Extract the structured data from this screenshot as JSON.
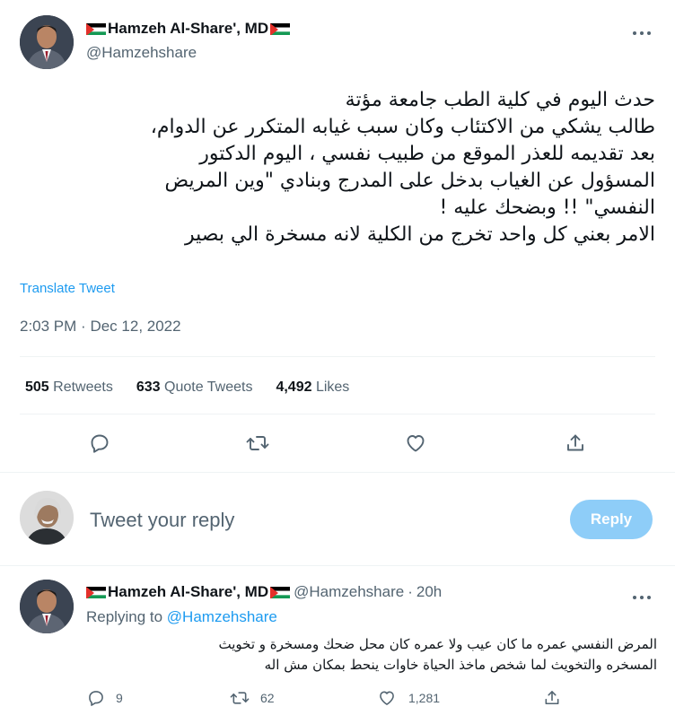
{
  "main_tweet": {
    "author_name": "Hamzeh Al-Share', MD",
    "author_handle": "@Hamzehshare",
    "text": "حدث اليوم في كلية الطب جامعة مؤتة\nطالب يشكي من الاكتئاب وكان سبب غيابه المتكرر عن الدوام،\nبعد تقديمه للعذر الموقع من طبيب نفسي ، اليوم الدكتور\nالمسؤول عن الغياب بدخل على المدرج وبنادي \"وين المريض\nالنفسي\" !! وبضحك عليه !\nالامر بعني كل واحد تخرج من الكلية لانه مسخرة الي بصير",
    "translate_label": "Translate Tweet",
    "time": "2:03 PM",
    "date": "Dec 12, 2022",
    "separator": "·",
    "retweets_count": "505",
    "retweets_label": "Retweets",
    "quote_count": "633",
    "quote_label": "Quote Tweets",
    "likes_count": "4,492",
    "likes_label": "Likes"
  },
  "reply_box": {
    "placeholder": "Tweet your reply",
    "button_label": "Reply"
  },
  "reply_tweet": {
    "author_name": "Hamzeh Al-Share', MD",
    "author_handle": "@Hamzehshare",
    "separator": "·",
    "time_ago": "20h",
    "replying_to_label": "Replying to",
    "replying_to_handle": "@Hamzehshare",
    "text": "المرض النفسي عمره ما كان عيب ولا عمره كان محل ضحك  ومسخرة و  تخويث\nالمسخره والتخويث لما شخص ماخذ الحياة خاوات ينحط بمكان مش اله",
    "reply_count": "9",
    "retweet_count": "62",
    "like_count": "1,281"
  },
  "icons": {
    "more": "more-horizontal-icon",
    "reply": "reply-bubble-icon",
    "retweet": "retweet-icon",
    "like": "heart-icon",
    "share": "share-upload-icon",
    "flag": "palestine-flag-icon"
  },
  "colors": {
    "accent": "#1d9bf0",
    "reply_button_disabled": "#8ecdf8",
    "secondary_text": "#536471",
    "divider": "#eff3f4"
  }
}
